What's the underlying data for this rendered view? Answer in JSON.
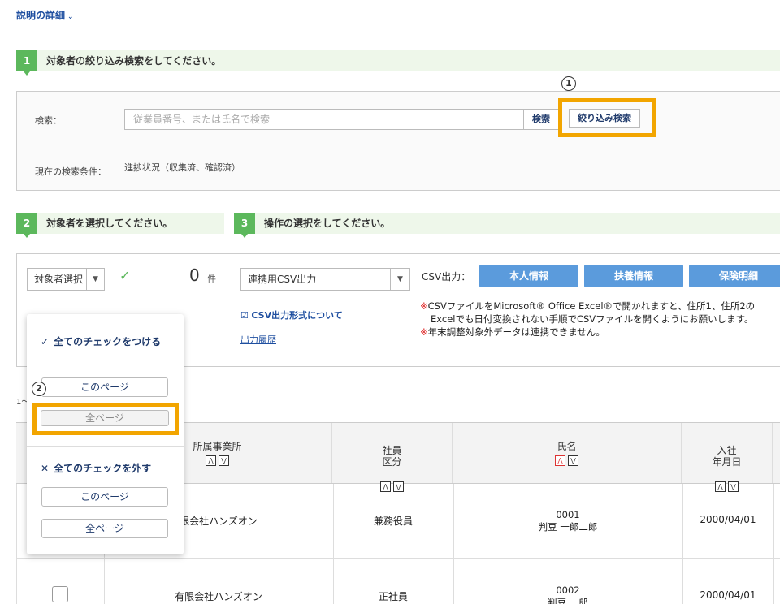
{
  "details_link": {
    "label": "説明の詳細",
    "chevron": "⌄"
  },
  "step1": {
    "num": "1",
    "text": "対象者の絞り込み検索をしてください。"
  },
  "search": {
    "label": "検索：",
    "placeholder": "従業員番号、または氏名で検索",
    "search_button": "検索",
    "filter_button": "絞り込み検索",
    "annotation": "1",
    "condition_label": "現在の検索条件：",
    "condition_value": "進捗状況（収集済、確認済）"
  },
  "step2": {
    "num": "2",
    "text": "対象者を選択してください。"
  },
  "step3": {
    "num": "3",
    "text": "操作の選択をしてください。"
  },
  "select_panel": {
    "select_label": "対象者選択",
    "check_mark": "✓",
    "count": "0",
    "count_unit": "件"
  },
  "operation": {
    "select_label": "連携用CSV出力",
    "csv_label": "CSV出力：",
    "buttons": [
      "本人情報",
      "扶養情報",
      "保険明細"
    ],
    "format_link": "CSV出力形式について",
    "history_link": "出力履歴",
    "notes": [
      {
        "mark": "※",
        "text": "CSVファイルをMicrosoft® Office Excel®で開かれますと、住所1、住所2の"
      },
      {
        "mark": "",
        "text": "Excelでも日付変換されない手順でCSVファイルを開くようにお願いします。"
      },
      {
        "mark": "※",
        "text": "年末調整対象外データは連携できません。"
      }
    ]
  },
  "popup": {
    "check_all_title": "全てのチェックをつける",
    "check_icon": "✓",
    "this_page": "このページ",
    "all_pages": "全ページ",
    "annotation": "2",
    "uncheck_all_title": "全てのチェックを外す",
    "uncheck_icon": "✕",
    "this_page2": "このページ",
    "all_pages2": "全ページ"
  },
  "pagination_text": "1〜",
  "table": {
    "headers": [
      {
        "label": "所属事業所",
        "sort_active": ""
      },
      {
        "label": "社員\n区分",
        "sort_active": ""
      },
      {
        "label": "氏名",
        "sort_active": "up"
      },
      {
        "label": "入社\n年月日",
        "sort_active": ""
      }
    ],
    "sort_up": "⋀",
    "sort_down": "⋁",
    "rows": [
      {
        "office": "有限会社ハンズオン",
        "office_visible": "限会社ハンズオン",
        "type": "兼務役員",
        "id": "0001",
        "name": "判豆 一郎二郎",
        "joined": "2000/04/01"
      },
      {
        "office": "有限会社ハンズオン",
        "type": "正社員",
        "id": "0002",
        "name": "判豆 一郎",
        "joined": "2000/04/01"
      }
    ]
  }
}
